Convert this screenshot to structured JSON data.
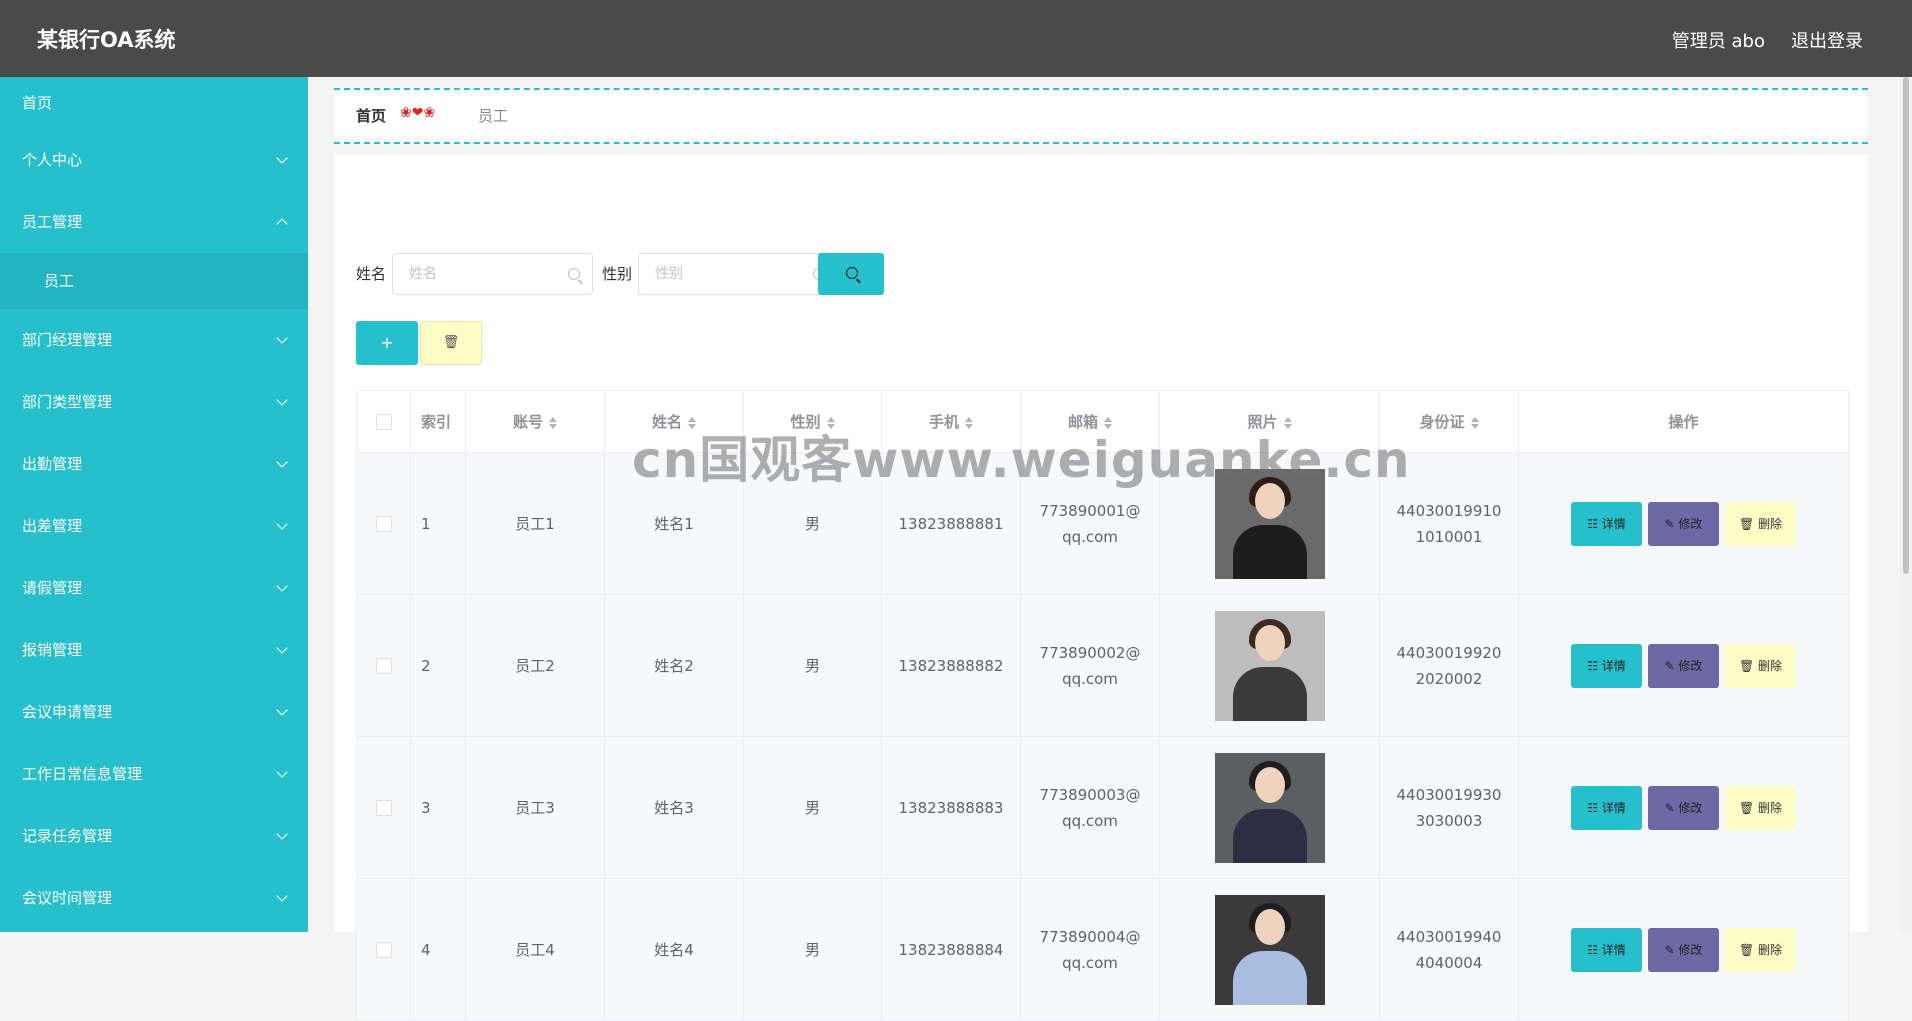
{
  "header": {
    "app_title": "某银行OA系统",
    "user_label": "管理员 abo",
    "logout_label": "退出登录"
  },
  "sidebar": {
    "items": [
      {
        "label": "首页",
        "chevron": "none"
      },
      {
        "label": "个人中心",
        "chevron": "down"
      },
      {
        "label": "员工管理",
        "chevron": "up",
        "children": [
          {
            "label": "员工"
          }
        ]
      },
      {
        "label": "部门经理管理",
        "chevron": "down"
      },
      {
        "label": "部门类型管理",
        "chevron": "down"
      },
      {
        "label": "出勤管理",
        "chevron": "down"
      },
      {
        "label": "出差管理",
        "chevron": "down"
      },
      {
        "label": "请假管理",
        "chevron": "down"
      },
      {
        "label": "报销管理",
        "chevron": "down"
      },
      {
        "label": "会议申请管理",
        "chevron": "down"
      },
      {
        "label": "工作日常信息管理",
        "chevron": "down"
      },
      {
        "label": "记录任务管理",
        "chevron": "down"
      },
      {
        "label": "会议时间管理",
        "chevron": "down"
      }
    ]
  },
  "breadcrumb": {
    "home": "首页",
    "separator": "❀❤❀",
    "current": "员工"
  },
  "search": {
    "name_label": "姓名",
    "name_placeholder": "姓名",
    "gender_label": "性别",
    "gender_placeholder": "性别"
  },
  "toolbar": {
    "add_label": "+",
    "delete_label": "🗑"
  },
  "table": {
    "columns": [
      "",
      "索引",
      "账号",
      "姓名",
      "性别",
      "手机",
      "邮箱",
      "照片",
      "身份证",
      "操作"
    ],
    "rows": [
      {
        "index": "1",
        "account": "员工1",
        "name": "姓名1",
        "gender": "男",
        "phone": "13823888881",
        "email": "773890001@qq.com",
        "idcard": "440300199101010001"
      },
      {
        "index": "2",
        "account": "员工2",
        "name": "姓名2",
        "gender": "男",
        "phone": "13823888882",
        "email": "773890002@qq.com",
        "idcard": "440300199202020002"
      },
      {
        "index": "3",
        "account": "员工3",
        "name": "姓名3",
        "gender": "男",
        "phone": "13823888883",
        "email": "773890003@qq.com",
        "idcard": "440300199303030003"
      },
      {
        "index": "4",
        "account": "员工4",
        "name": "姓名4",
        "gender": "男",
        "phone": "13823888884",
        "email": "773890004@qq.com",
        "idcard": "440300199404040004"
      }
    ],
    "actions": {
      "detail": "详情",
      "edit": "修改",
      "delete": "删除"
    }
  },
  "watermark": "cn国观客www.weiguanke.cn",
  "colors": {
    "accent": "#26c0cc",
    "header_bg": "#4a4a4a",
    "edit_button": "#6c6aa6",
    "delete_button": "#fffdc6"
  }
}
